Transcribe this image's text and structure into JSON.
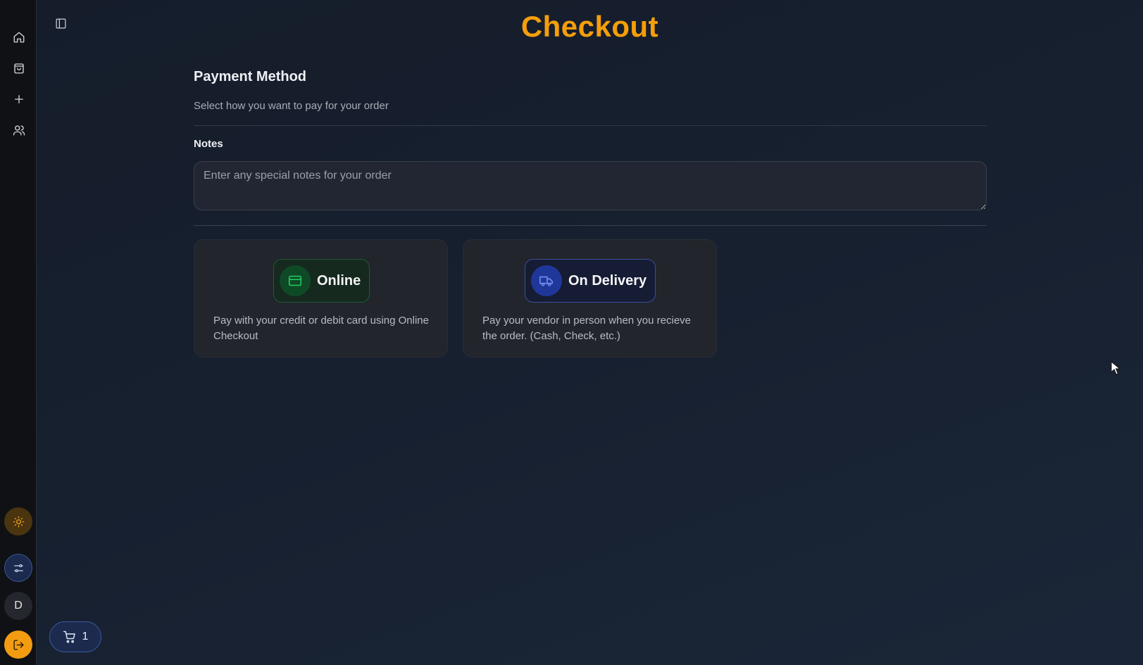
{
  "page": {
    "title": "Checkout"
  },
  "sidebar": {
    "items": [
      {
        "icon": "home-icon"
      },
      {
        "icon": "shopping-bag-icon"
      },
      {
        "icon": "plus-icon"
      },
      {
        "icon": "users-icon"
      }
    ],
    "theme_icon": "sun-icon",
    "filter_icon": "sliders-icon",
    "avatar_initial": "D",
    "logout_icon": "logout-icon"
  },
  "payment": {
    "title": "Payment Method",
    "subtitle": "Select how you want to pay for your order",
    "notes_label": "Notes",
    "notes_placeholder": "Enter any special notes for your order",
    "notes_value": "",
    "options": [
      {
        "label": "Online",
        "icon": "credit-card-icon",
        "description": "Pay with your credit or debit card using Online Checkout",
        "accent": "#22c55e"
      },
      {
        "label": "On Delivery",
        "icon": "truck-icon",
        "description": "Pay your vendor in person when you recieve the order. (Cash, Check, etc.)",
        "accent": "#6f8cf0"
      }
    ]
  },
  "cart": {
    "count": "1",
    "icon": "cart-icon"
  },
  "colors": {
    "accent": "#f59e0b",
    "online": "#22c55e",
    "delivery": "#3b5bdb"
  }
}
